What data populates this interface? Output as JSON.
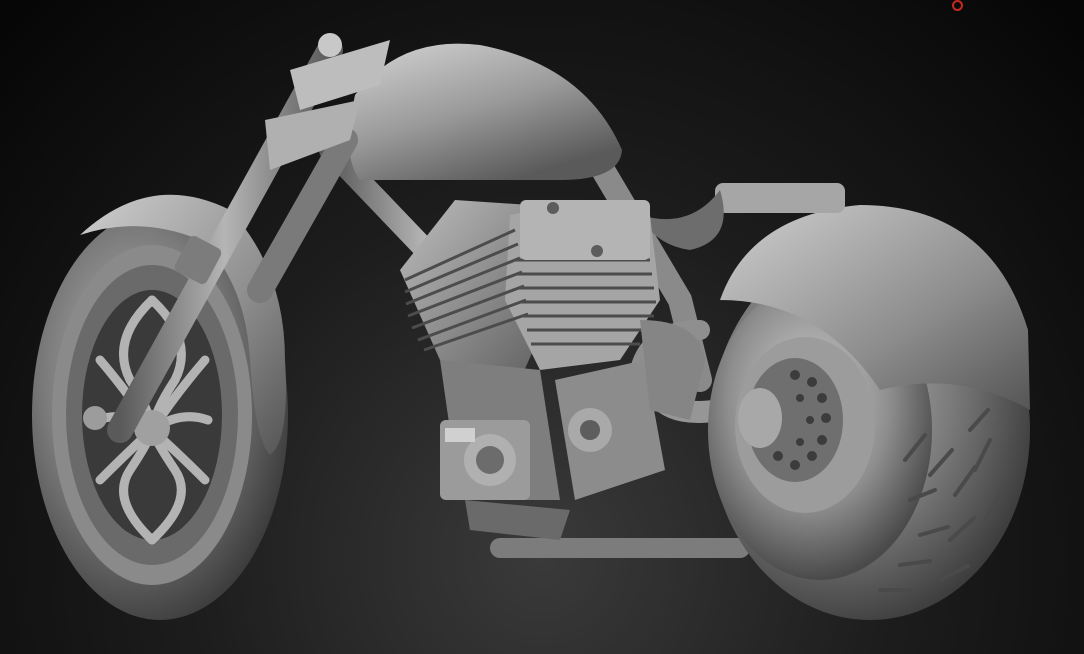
{
  "scene": {
    "subject": "motorcycle-3d-sculpt",
    "background_color": "#000000",
    "material_color": "#9a9a9a",
    "marker_color": "#c8281e"
  }
}
